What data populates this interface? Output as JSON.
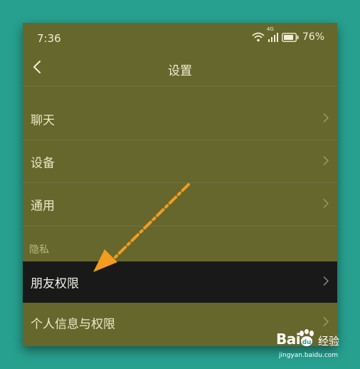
{
  "status_bar": {
    "time": "7:36",
    "network": "4G",
    "battery": "76%"
  },
  "nav": {
    "title": "设置"
  },
  "rows_top": [
    {
      "label": "聊天"
    },
    {
      "label": "设备"
    },
    {
      "label": "通用"
    }
  ],
  "section_header": "隐私",
  "rows_privacy": [
    {
      "label": "朋友权限"
    },
    {
      "label": "个人信息与权限"
    }
  ],
  "watermark": {
    "brand_left": "Bai",
    "brand_right": "经验",
    "url": "jingyan.baidu.com"
  },
  "colors": {
    "background": "#27a08f",
    "screen": "#66672c",
    "highlight": "#191919",
    "arrow": "#f39c1e"
  }
}
